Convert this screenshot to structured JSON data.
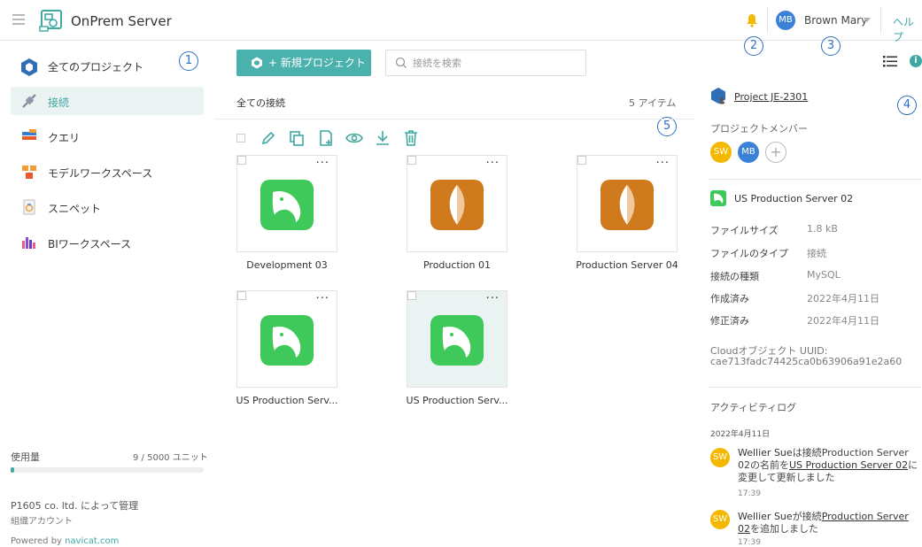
{
  "header": {
    "app_title": "OnPrem Server",
    "user_initials": "MB",
    "user_name": "Brown Mary",
    "help_label": "ヘルプ",
    "icons": [
      "menu-icon",
      "app-logo-icon",
      "bell-icon",
      "caret-down-icon"
    ]
  },
  "callouts": [
    "1",
    "2",
    "3",
    "4",
    "5"
  ],
  "sidebar": {
    "all_projects_label": "全てのプロジェクト",
    "items": [
      {
        "label": "接続",
        "icon": "connection-icon",
        "active": true
      },
      {
        "label": "クエリ",
        "icon": "query-icon",
        "active": false
      },
      {
        "label": "モデルワークスペース",
        "icon": "model-workspace-icon",
        "active": false
      },
      {
        "label": "スニペット",
        "icon": "snippet-icon",
        "active": false
      },
      {
        "label": "BIワークスペース",
        "icon": "bi-workspace-icon",
        "active": false
      }
    ],
    "usage_label": "使用量",
    "usage_value": "9 / 5000 ユニット",
    "usage_fraction": 0.0018,
    "managed_by": "P1605 co. ltd. によって管理",
    "org_account": "組織アカウント",
    "powered_by": "Powered by ",
    "powered_link": "navicat.com"
  },
  "main": {
    "new_project_label": "+ 新規プロジェクト",
    "search_placeholder": "接続を検索",
    "section_title": "全ての接続",
    "item_count": "5 アイテム",
    "toolbar_icons": [
      "edit-icon",
      "duplicate-icon",
      "new-file-icon",
      "view-icon",
      "download-icon",
      "delete-icon"
    ],
    "cards": [
      {
        "label": "Development 03",
        "type": "mysql",
        "selected": false
      },
      {
        "label": "Production 01",
        "type": "mongodb",
        "selected": false
      },
      {
        "label": "Production Server 04",
        "type": "mongodb",
        "selected": false
      },
      {
        "label": "US Production Serv...",
        "type": "mysql",
        "selected": false
      },
      {
        "label": "US Production Serv...",
        "type": "mysql",
        "selected": true
      }
    ]
  },
  "details": {
    "project_name": "Project JE-2301",
    "members_title": "プロジェクトメンバー",
    "members": [
      {
        "initials": "SW",
        "color": "#f5b800"
      },
      {
        "initials": "MB",
        "color": "#3b82d6"
      }
    ],
    "add_member": "+",
    "file_name": "US Production Server 02",
    "props": [
      {
        "key": "ファイルサイズ",
        "value": "1.8 kB"
      },
      {
        "key": "ファイルのタイプ",
        "value": "接続"
      },
      {
        "key": "接続の種類",
        "value": "MySQL"
      },
      {
        "key": "作成済み",
        "value": "2022年4月11日"
      },
      {
        "key": "修正済み",
        "value": "2022年4月11日"
      }
    ],
    "uuid_label": "Cloudオブジェクト UUID:",
    "uuid_value": "cae713fadc74425ca0b63906a91e2a60",
    "activity_title": "アクティビティログ",
    "activity_date": "2022年4月11日",
    "activities": [
      {
        "initials": "SW",
        "who": "Wellier Sue",
        "p1": "は接続",
        "obj": "Production Server 02",
        "p2": "の名前を",
        "link": "US Production Server 02",
        "p3": "に変更して更新しました",
        "time": "17:39"
      },
      {
        "initials": "SW",
        "who": "Wellier Sue",
        "p1": "が接続",
        "link": "Production Server 02",
        "p2": "を追加しました",
        "time": "17:39"
      }
    ]
  },
  "colors": {
    "accent": "#3ea8a3",
    "button": "#4bb1ac",
    "mysql": "#3ec95a",
    "mongodb": "#d07a1e",
    "avatar_blue": "#3b82d6",
    "avatar_yellow": "#f5b800",
    "callout": "#2d6fbf"
  }
}
